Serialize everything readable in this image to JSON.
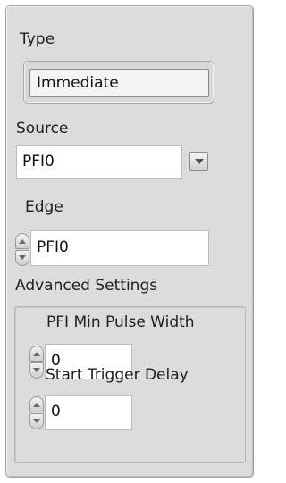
{
  "type_section": {
    "label": "Type",
    "value": "Immediate"
  },
  "source_section": {
    "label": "Source",
    "value": "PFI0"
  },
  "edge_section": {
    "label": "Edge",
    "value": "PFI0"
  },
  "advanced_section": {
    "label": "Advanced Settings",
    "pfi_min_pulse_width": {
      "label": "PFI Min Pulse Width",
      "value": "0"
    },
    "start_trigger_delay": {
      "label": "Start Trigger Delay",
      "value": "0"
    }
  },
  "icons": {
    "dropdown": "chevron-down-icon",
    "increment": "arrow-up-icon",
    "decrement": "arrow-down-icon"
  }
}
